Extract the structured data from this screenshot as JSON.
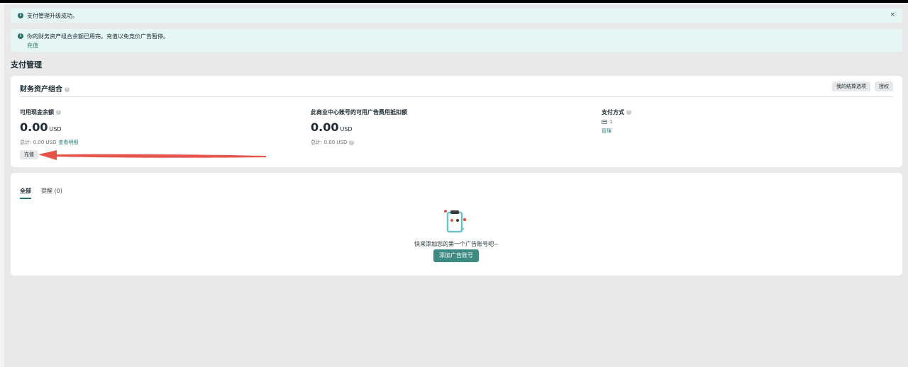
{
  "banners": {
    "success_text": "支付管理升级成功。",
    "close_label": "×",
    "warning_text": "你的财务资产组合余额已用完。充值以免竞价广告暂停。",
    "warning_link": "充值"
  },
  "page": {
    "title": "支付管理"
  },
  "finance": {
    "title": "财务资产组合",
    "settlement_button": "我的结算选项",
    "auth_button": "授权",
    "cash": {
      "label": "可用现金余额",
      "amount": "0.00",
      "currency": "USD",
      "total": "总计: 0.00 USD",
      "detail_link": "查看明细",
      "recharge_button": "充值"
    },
    "credit": {
      "label": "此商业中心账号的可用广告费用抵扣额",
      "amount": "0.00",
      "currency": "USD",
      "total": "总计: 0.00 USD"
    },
    "payment": {
      "label": "支付方式",
      "count": "1",
      "manage_link": "管理"
    }
  },
  "accounts": {
    "tabs": [
      {
        "label": "全部",
        "active": true
      },
      {
        "label": "提醒 (0)",
        "active": false
      }
    ],
    "empty_text": "快来添加您的第一个广告账号吧~",
    "add_button": "添加广告账号"
  },
  "colors": {
    "accent": "#3e8a82",
    "banner_bg": "#e5f6f4",
    "arrow": "#e5534b"
  },
  "icons": [
    "info-icon",
    "close-icon",
    "help-icon",
    "card-icon",
    "clipboard-illustration",
    "arrow-annotation"
  ]
}
